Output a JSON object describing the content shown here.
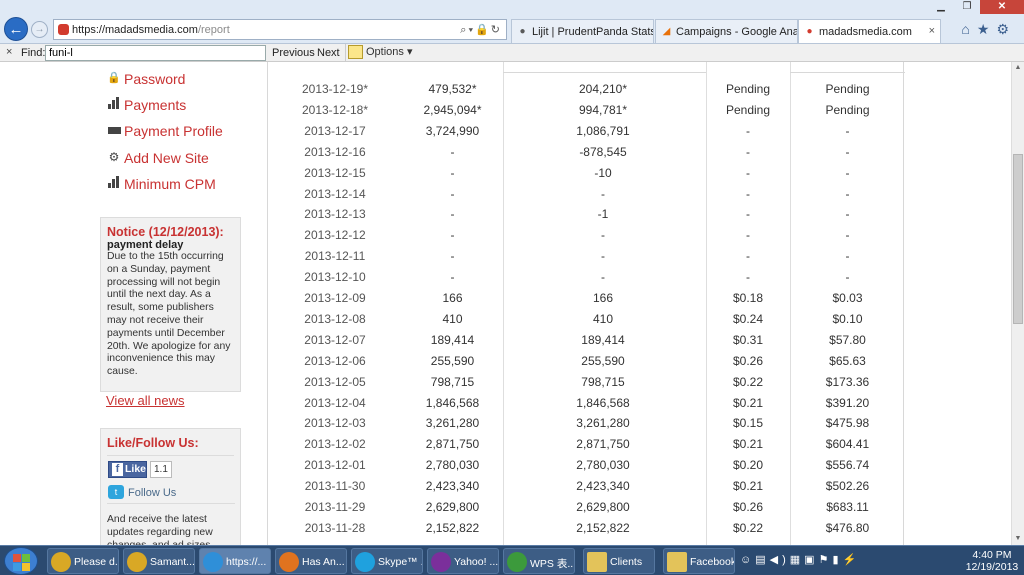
{
  "browser": {
    "url_host": "https://madadsmedia.com",
    "url_path": "/report",
    "tabs": [
      {
        "label": "Lijit | PrudentPanda Stats",
        "icon": "lijit-icon",
        "active": false
      },
      {
        "label": "Campaigns - Google Analytics",
        "icon": "analytics-icon",
        "active": false
      },
      {
        "label": "madadsmedia.com",
        "icon": "madads-icon",
        "active": true
      }
    ],
    "close_tab": "×"
  },
  "findbar": {
    "close": "×",
    "label": "Find:",
    "value": "funi-l",
    "previous": "Previous",
    "next": "Next",
    "options": "Options ▾"
  },
  "sidebar": {
    "items": [
      {
        "label": "Password",
        "icon": "lock-icon"
      },
      {
        "label": "Payments",
        "icon": "bar-chart-icon"
      },
      {
        "label": "Payment Profile",
        "icon": "credit-card-icon"
      },
      {
        "label": "Add New Site",
        "icon": "gear-icon"
      },
      {
        "label": "Minimum CPM",
        "icon": "bar-chart-icon"
      }
    ],
    "notice": {
      "title": "Notice (12/12/2013):",
      "subtitle": "payment delay",
      "body": "Due to the 15th occurring on a Sunday, payment processing will not begin until the next day.  As a result, some publishers may not receive their payments until December 20th.  We apologize for any inconvenience this may cause."
    },
    "view_all_news": "View all news",
    "social": {
      "title": "Like/Follow Us:",
      "like_label": "Like",
      "like_count": "1.1",
      "follow_label": "Follow Us",
      "text": "And receive the latest updates regarding new changes, and ad sizes."
    }
  },
  "report": {
    "rows": [
      {
        "date": "2013-12-19*",
        "impressions": "479,532*",
        "clicks": "204,210*",
        "cpm": "Pending",
        "revenue": "Pending"
      },
      {
        "date": "2013-12-18*",
        "impressions": "2,945,094*",
        "clicks": "994,781*",
        "cpm": "Pending",
        "revenue": "Pending"
      },
      {
        "date": "2013-12-17",
        "impressions": "3,724,990",
        "clicks": "1,086,791",
        "cpm": "-",
        "revenue": "-"
      },
      {
        "date": "2013-12-16",
        "impressions": "-",
        "clicks": "-878,545",
        "cpm": "-",
        "revenue": "-"
      },
      {
        "date": "2013-12-15",
        "impressions": "-",
        "clicks": "-10",
        "cpm": "-",
        "revenue": "-"
      },
      {
        "date": "2013-12-14",
        "impressions": "-",
        "clicks": "-",
        "cpm": "-",
        "revenue": "-"
      },
      {
        "date": "2013-12-13",
        "impressions": "-",
        "clicks": "-1",
        "cpm": "-",
        "revenue": "-"
      },
      {
        "date": "2013-12-12",
        "impressions": "-",
        "clicks": "-",
        "cpm": "-",
        "revenue": "-"
      },
      {
        "date": "2013-12-11",
        "impressions": "-",
        "clicks": "-",
        "cpm": "-",
        "revenue": "-"
      },
      {
        "date": "2013-12-10",
        "impressions": "-",
        "clicks": "-",
        "cpm": "-",
        "revenue": "-"
      },
      {
        "date": "2013-12-09",
        "impressions": "166",
        "clicks": "166",
        "cpm": "$0.18",
        "revenue": "$0.03"
      },
      {
        "date": "2013-12-08",
        "impressions": "410",
        "clicks": "410",
        "cpm": "$0.24",
        "revenue": "$0.10"
      },
      {
        "date": "2013-12-07",
        "impressions": "189,414",
        "clicks": "189,414",
        "cpm": "$0.31",
        "revenue": "$57.80"
      },
      {
        "date": "2013-12-06",
        "impressions": "255,590",
        "clicks": "255,590",
        "cpm": "$0.26",
        "revenue": "$65.63"
      },
      {
        "date": "2013-12-05",
        "impressions": "798,715",
        "clicks": "798,715",
        "cpm": "$0.22",
        "revenue": "$173.36"
      },
      {
        "date": "2013-12-04",
        "impressions": "1,846,568",
        "clicks": "1,846,568",
        "cpm": "$0.21",
        "revenue": "$391.20"
      },
      {
        "date": "2013-12-03",
        "impressions": "3,261,280",
        "clicks": "3,261,280",
        "cpm": "$0.15",
        "revenue": "$475.98"
      },
      {
        "date": "2013-12-02",
        "impressions": "2,871,750",
        "clicks": "2,871,750",
        "cpm": "$0.21",
        "revenue": "$604.41"
      },
      {
        "date": "2013-12-01",
        "impressions": "2,780,030",
        "clicks": "2,780,030",
        "cpm": "$0.20",
        "revenue": "$556.74"
      },
      {
        "date": "2013-11-30",
        "impressions": "2,423,340",
        "clicks": "2,423,340",
        "cpm": "$0.21",
        "revenue": "$502.26"
      },
      {
        "date": "2013-11-29",
        "impressions": "2,629,800",
        "clicks": "2,629,800",
        "cpm": "$0.26",
        "revenue": "$683.11"
      },
      {
        "date": "2013-11-28",
        "impressions": "2,152,822",
        "clicks": "2,152,822",
        "cpm": "$0.22",
        "revenue": "$476.80"
      }
    ]
  },
  "taskbar": {
    "items": [
      {
        "label": "Please d...",
        "icon": "chrome-icon",
        "color": "#d9a825"
      },
      {
        "label": "Samant...",
        "icon": "chrome-icon",
        "color": "#d9a825"
      },
      {
        "label": "https://...",
        "icon": "ie-icon",
        "color": "#2f8fd8"
      },
      {
        "label": "Has An...",
        "icon": "firefox-icon",
        "color": "#e0731f"
      },
      {
        "label": "Skype™ ...",
        "icon": "skype-icon",
        "color": "#1fa1de"
      },
      {
        "label": "Yahoo! ...",
        "icon": "yahoo-icon",
        "color": "#7b2f9b"
      },
      {
        "label": "WPS 表...",
        "icon": "wps-icon",
        "color": "#3c9a3c"
      },
      {
        "label": "Clients",
        "icon": "folder-icon",
        "color": "#e3c35a"
      },
      {
        "label": "Facebook",
        "icon": "folder-icon",
        "color": "#e3c35a"
      }
    ],
    "clock_time": "4:40 PM",
    "clock_date": "12/19/2013"
  },
  "colors": {
    "accent_red": "#c83232",
    "taskbar_bg": "#2b4a70",
    "window_frame": "#dfe9f5"
  }
}
